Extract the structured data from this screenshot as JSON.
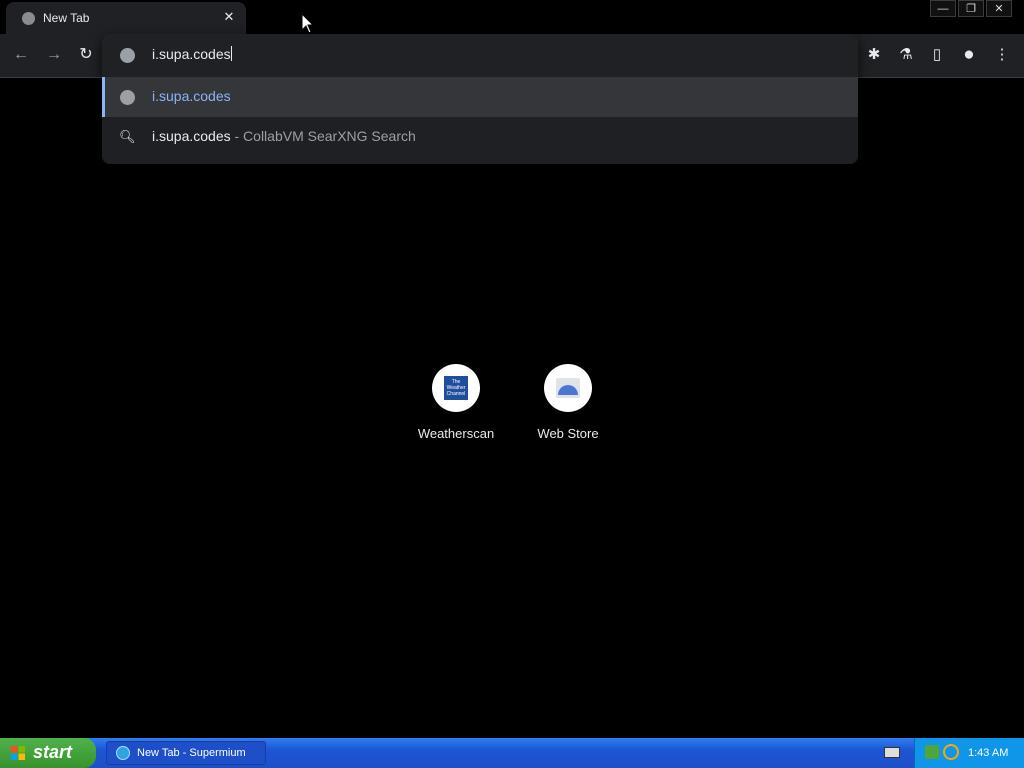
{
  "tab": {
    "title": "New Tab",
    "close": "✕"
  },
  "window_controls": {
    "minimize": "—",
    "restore": "❐",
    "close": "✕"
  },
  "toolbar": {
    "back": "←",
    "forward": "→",
    "reload": "↻",
    "extensions": "✱",
    "labs": "⚗",
    "side_panel": "▯",
    "profile": "●",
    "menu": "⋮"
  },
  "omnibox": {
    "value": "i.supa.codes",
    "suggestions": [
      {
        "text": "i.supa.codes",
        "sub": "",
        "icon": "globe-icon",
        "selected": true
      },
      {
        "text": "i.supa.codes",
        "sub": " - CollabVM SearXNG Search",
        "icon": "search-icon",
        "selected": false
      }
    ]
  },
  "shortcuts": [
    {
      "label": "Weatherscan",
      "icon_text": "The Weather Channel"
    },
    {
      "label": "Web Store"
    }
  ],
  "taskbar": {
    "start_label": "start",
    "task_label": "New Tab - Supermium",
    "clock": "1:43 AM"
  },
  "colors": {
    "accent": "#8ab4f8",
    "toolbar_bg": "#202124",
    "page_bg": "#000000"
  }
}
